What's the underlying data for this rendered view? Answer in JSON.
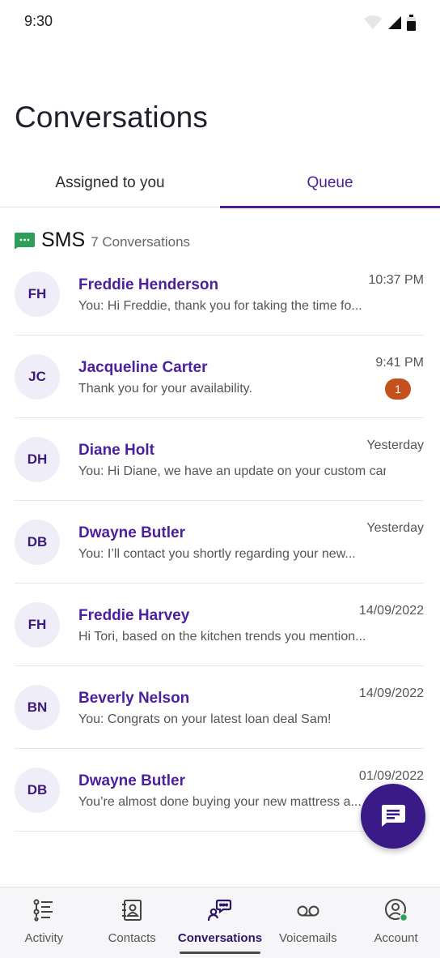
{
  "status_bar": {
    "time": "9:30"
  },
  "header": {
    "title": "Conversations"
  },
  "tabs": [
    {
      "label": "Assigned to you",
      "active": false
    },
    {
      "label": "Queue",
      "active": true
    }
  ],
  "section": {
    "title": "SMS",
    "count": "7 Conversations",
    "icon": "sms-icon"
  },
  "conversations": [
    {
      "initials": "FH",
      "name": "Freddie Henderson",
      "preview": "You: Hi Freddie, thank you for taking the time fo...",
      "time": "10:37 PM",
      "badge": ""
    },
    {
      "initials": "JC",
      "name": "Jacqueline Carter",
      "preview": "Thank you for your availability.",
      "time": "9:41 PM",
      "badge": "1"
    },
    {
      "initials": "DH",
      "name": "Diane Holt",
      "preview": "You: Hi Diane, we have an update on your custom car...",
      "time": "Yesterday",
      "badge": ""
    },
    {
      "initials": "DB",
      "name": "Dwayne Butler",
      "preview": "You: I’ll contact you shortly regarding your new...",
      "time": "Yesterday",
      "badge": ""
    },
    {
      "initials": "FH",
      "name": "Freddie Harvey",
      "preview": "Hi Tori, based on the kitchen trends you mention...",
      "time": "14/09/2022",
      "badge": ""
    },
    {
      "initials": "BN",
      "name": "Beverly Nelson",
      "preview": "You: Congrats on your latest loan deal Sam!",
      "time": "14/09/2022",
      "badge": ""
    },
    {
      "initials": "DB",
      "name": "Dwayne Butler",
      "preview": "You’re almost done buying your new mattress a...",
      "time": "01/09/2022",
      "badge": ""
    }
  ],
  "fab": {
    "icon": "new-message-icon"
  },
  "bottom_nav": [
    {
      "label": "Activity",
      "icon": "activity-icon"
    },
    {
      "label": "Contacts",
      "icon": "contacts-icon"
    },
    {
      "label": "Conversations",
      "icon": "conversations-icon",
      "active": true
    },
    {
      "label": "Voicemails",
      "icon": "voicemail-icon"
    },
    {
      "label": "Account",
      "icon": "account-icon"
    }
  ],
  "colors": {
    "accent": "#4b1fa0",
    "fab": "#3a1a86",
    "badge": "#c4501c",
    "sms_icon": "#2e9f5a",
    "online": "#2e9f5a"
  }
}
